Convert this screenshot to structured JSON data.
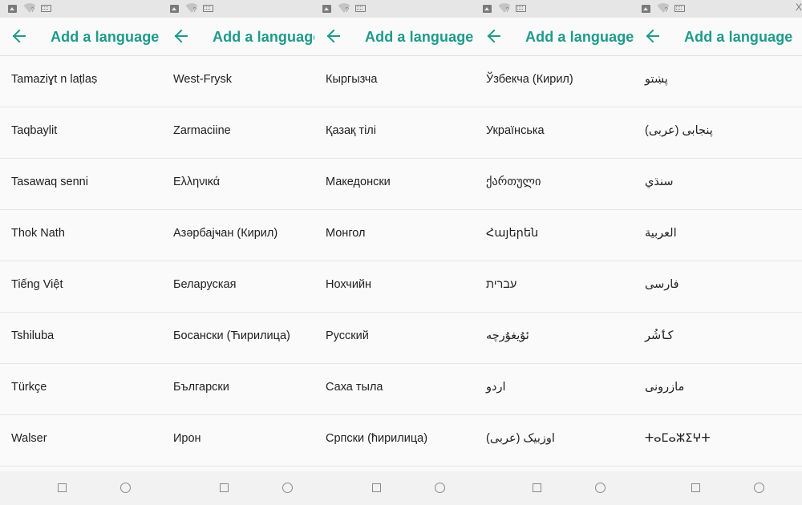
{
  "app": {
    "title": "Add a language",
    "accent_color": "#1e9a8b"
  },
  "status_bar": {
    "icons": [
      "image-icon",
      "wifi-icon",
      "keyboard-icon"
    ],
    "edge_glyph": "X"
  },
  "nav_bar": {
    "buttons": [
      "recents-button",
      "home-button"
    ]
  },
  "screens": [
    {
      "languages": [
        "Tamaziɣt n laṭlaṣ",
        "Taqbaylit",
        "Tasawaq senni",
        "Thok Nath",
        "Tiếng Việt",
        "Tshiluba",
        "Türkçe",
        "Walser"
      ]
    },
    {
      "languages": [
        "West-Frysk",
        "Zarmaciine",
        "Ελληνικά",
        "Азәрбајҹан (Кирил)",
        "Беларуская",
        "Босански (Ћирилица)",
        "Български",
        "Ирон"
      ]
    },
    {
      "languages": [
        "Кыргызча",
        "Қазақ тілі",
        "Македонски",
        "Монгол",
        "Нохчийн",
        "Русский",
        "Саха тыла",
        "Српски (ћирилица)"
      ]
    },
    {
      "languages": [
        "Ўзбекча (Кирил)",
        "Українська",
        "ქართული",
        "Հայերեն",
        "עברית",
        "ئۇيغۇرچە",
        "اردو",
        "اوزبیک (عربی)"
      ]
    },
    {
      "languages": [
        "پښتو",
        "پنجابی (عربی)",
        "سنڌي",
        "العربية",
        "فارسی",
        "کٲشُر",
        "مازرونی",
        "ⵜⴰⵎⴰⵣⵉⵖⵜ"
      ]
    }
  ]
}
